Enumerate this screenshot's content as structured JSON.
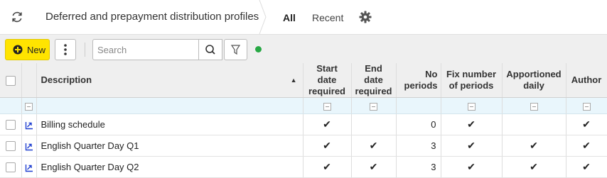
{
  "header": {
    "title": "Deferred and prepayment distribution profiles",
    "tabs": [
      {
        "label": "All",
        "active": true
      },
      {
        "label": "Recent",
        "active": false
      }
    ],
    "icons": [
      "refresh-icon",
      "gear-icon"
    ]
  },
  "toolbar": {
    "new_label": "New",
    "search_placeholder": "Search",
    "status_color": "#27a844",
    "accent_color": "#ffe400"
  },
  "grid": {
    "columns": [
      {
        "key": "description",
        "label": "Description",
        "sorted": "ascending"
      },
      {
        "key": "start_date_required",
        "label": "Start date required"
      },
      {
        "key": "end_date_required",
        "label": "End date required"
      },
      {
        "key": "no_periods",
        "label": "No periods"
      },
      {
        "key": "fix_number_of_periods",
        "label": "Fix number of periods"
      },
      {
        "key": "apportioned_daily",
        "label": "Apportioned daily"
      },
      {
        "key": "author",
        "label": "Author"
      }
    ],
    "rows": [
      {
        "description": "Billing schedule",
        "start_date_required": "✔",
        "end_date_required": "",
        "no_periods": "0",
        "fix_number_of_periods": "✔",
        "apportioned_daily": "",
        "author": "✔"
      },
      {
        "description": "English Quarter Day Q1",
        "start_date_required": "✔",
        "end_date_required": "✔",
        "no_periods": "3",
        "fix_number_of_periods": "✔",
        "apportioned_daily": "✔",
        "author": "✔"
      },
      {
        "description": "English Quarter Day Q2",
        "start_date_required": "✔",
        "end_date_required": "✔",
        "no_periods": "3",
        "fix_number_of_periods": "✔",
        "apportioned_daily": "✔",
        "author": "✔"
      }
    ]
  }
}
